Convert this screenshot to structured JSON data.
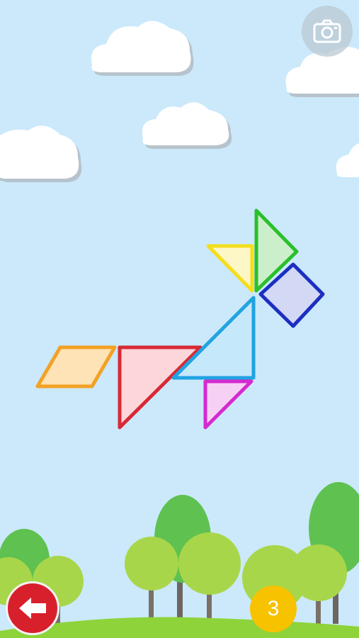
{
  "screen": {
    "name": "tangram-puzzle-fox"
  },
  "colors": {
    "sky": "#cbe9fb",
    "grass": "#8ed33a",
    "back_button": "#d8202c",
    "badge": "#f7c200"
  },
  "toolbar": {
    "camera_icon": "camera-icon"
  },
  "footer": {
    "back_icon": "left-arrow-icon",
    "level_number": "3"
  },
  "pieces": [
    {
      "id": "orange-parallelogram",
      "shape": "parallelogram",
      "stroke": "#f3a125",
      "fill": "#fde3b6"
    },
    {
      "id": "red-large-triangle",
      "shape": "triangle",
      "stroke": "#d72a36",
      "fill": "#fdd6d9"
    },
    {
      "id": "blue-large-triangle",
      "shape": "triangle",
      "stroke": "#22a3e2",
      "fill": "#c6e8fb"
    },
    {
      "id": "magenta-small-triangle",
      "shape": "triangle",
      "stroke": "#d52ad0",
      "fill": "#f7d0f6"
    },
    {
      "id": "yellow-small-triangle",
      "shape": "triangle",
      "stroke": "#f4de1d",
      "fill": "#fdf6c6"
    },
    {
      "id": "green-medium-triangle",
      "shape": "triangle",
      "stroke": "#2bbf2a",
      "fill": "#ccefcb"
    },
    {
      "id": "navy-square",
      "shape": "square",
      "stroke": "#1c2fc2",
      "fill": "#d3d8f5"
    }
  ]
}
